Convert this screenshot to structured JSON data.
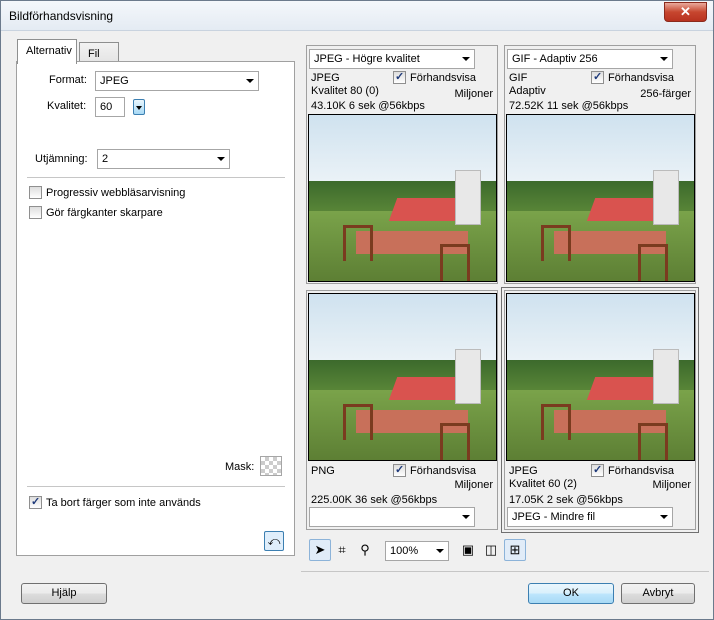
{
  "window": {
    "title": "Bildförhandsvisning",
    "close_glyph": "✕"
  },
  "tabs": [
    {
      "label": "Alternativ"
    },
    {
      "label": "Fil"
    }
  ],
  "options": {
    "format_label": "Format:",
    "format_value": "JPEG",
    "quality_label": "Kvalitet:",
    "quality_value": "60",
    "smoothing_label": "Utjämning:",
    "smoothing_value": "2",
    "progressive_label": "Progressiv webbläsarvisning",
    "progressive_checked": false,
    "sharpen_label": "Gör färgkanter skarpare",
    "sharpen_checked": false,
    "mask_label": "Mask:",
    "remove_colors_label": "Ta bort färger som inte används",
    "remove_colors_checked": true
  },
  "panes": [
    {
      "preset": "JPEG - Högre kvalitet",
      "format": "JPEG",
      "preview_label": "Förhandsvisa",
      "preview_checked": true,
      "line2_left": "Kvalitet 80 (0)",
      "line2_right": "Miljoner",
      "stats": "43.10K  6 sek @56kbps"
    },
    {
      "preset": "GIF - Adaptiv 256",
      "format": "GIF",
      "preview_label": "Förhandsvisa",
      "preview_checked": true,
      "line2_left": "Adaptiv",
      "line2_right": "256-färger",
      "stats": "72.52K  11 sek @56kbps"
    },
    {
      "preset": "",
      "format": "PNG",
      "preview_label": "Förhandsvisa",
      "preview_checked": true,
      "line2_left": "",
      "line2_right": "Miljoner",
      "stats": "225.00K  36 sek @56kbps"
    },
    {
      "preset": "JPEG - Mindre fil",
      "format": "JPEG",
      "preview_label": "Förhandsvisa",
      "preview_checked": true,
      "line2_left": "Kvalitet 60 (2)",
      "line2_right": "Miljoner",
      "stats": "17.05K  2 sek @56kbps"
    }
  ],
  "toolbar": {
    "zoom": "100%",
    "icons": [
      "pointer-icon",
      "crop-icon",
      "zoom-icon",
      "image-icon",
      "two-up-icon",
      "four-up-icon"
    ]
  },
  "buttons": {
    "help": "Hjälp",
    "ok": "OK",
    "cancel": "Avbryt"
  }
}
